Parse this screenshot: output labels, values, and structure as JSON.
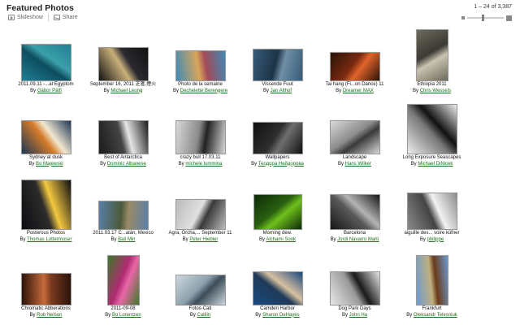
{
  "header": {
    "title": "Featured Photos",
    "slideshow_label": "Slideshow",
    "share_label": "Share",
    "pager_text": "1 – 24 of 3,387",
    "size_level": 0.4
  },
  "photos": [
    {
      "caption": "2011.09.11 -...at Egyptom",
      "by": "By",
      "author": "Gábor Pálfi",
      "colors": [
        "#1f7f94",
        "#3aa0a8",
        "#0e4d60"
      ]
    },
    {
      "caption": "September 16, 2011 芝滙.煙火",
      "by": "By",
      "author": "Michael Leung",
      "colors": [
        "#111111",
        "#2a2a30",
        "#c9b07a"
      ]
    },
    {
      "caption": "Photo de la semaine",
      "by": "By",
      "author": "Dechelette Berengere",
      "colors": [
        "#3f8ab6",
        "#a24a5a",
        "#d8a65a"
      ]
    },
    {
      "caption": "Vissende Fuut",
      "by": "By",
      "author": "Jan Althof",
      "colors": [
        "#355b78",
        "#6f8fa6",
        "#1e3447"
      ]
    },
    {
      "caption": "Tai hang (Fi...on Dance) 11",
      "by": "By",
      "author": "Dreamer MAX",
      "colors": [
        "#2a1208",
        "#e0642a",
        "#7a2a10"
      ]
    },
    {
      "caption": "Ethiopia 2011",
      "by": "By",
      "author": "Chris Wessels",
      "colors": [
        "#6c6a5c",
        "#c9c3b0",
        "#3b3a33"
      ]
    },
    {
      "caption": "Sydney at dusk",
      "by": "By",
      "author": "Bo Majewski",
      "colors": [
        "#1b3556",
        "#f2e8d0",
        "#d47b2a"
      ]
    },
    {
      "caption": "Best of Antarctica",
      "by": "By",
      "author": "Dominic Albanese",
      "colors": [
        "#1a1a1a",
        "#e6e6e6",
        "#444444"
      ]
    },
    {
      "caption": "crazy bull 17.03.11",
      "by": "By",
      "author": "michele lummina",
      "colors": [
        "#d8d8d8",
        "#222222",
        "#8a8a8a"
      ]
    },
    {
      "caption": "Wallpapers",
      "by": "By",
      "author": "Теодора Нейдорова",
      "colors": [
        "#101010",
        "#6e6e6e",
        "#2e2e2e"
      ]
    },
    {
      "caption": "Landscape",
      "by": "By",
      "author": "Hans Wilker",
      "colors": [
        "#d9d9d9",
        "#3a3a3a",
        "#8c8c8c"
      ]
    },
    {
      "caption": "Long Exposure Seascapes",
      "by": "By",
      "author": "Michael DiNicek",
      "colors": [
        "#eeeeee",
        "#111111",
        "#777777"
      ]
    },
    {
      "caption": "Posterous Photos",
      "by": "By",
      "author": "Thomas Lottermoser",
      "colors": [
        "#0d0d12",
        "#f3c840",
        "#2c2c2c"
      ]
    },
    {
      "caption": "2011.03.17 C...atán, Mexico",
      "by": "By",
      "author": "Bali Min",
      "colors": [
        "#5a7fa8",
        "#9a8a66",
        "#4a5a3a"
      ]
    },
    {
      "caption": "Agra, Orcha,... September 11",
      "by": "By",
      "author": "Peter Hiebler",
      "colors": [
        "#bbbbbb",
        "#3a3a3a",
        "#e0e0e0"
      ]
    },
    {
      "caption": "Morning dew.",
      "by": "By",
      "author": "Alchami Sook",
      "colors": [
        "#0d2a08",
        "#6ec01c",
        "#2a6010"
      ]
    },
    {
      "caption": "Barcelona",
      "by": "By",
      "author": "Jordi Navarro Martí",
      "colors": [
        "#151515",
        "#b4b4b4",
        "#5a5a5a"
      ]
    },
    {
      "caption": "aiguille des... voire küfner",
      "by": "By",
      "author": "philippe",
      "colors": [
        "#8a8a8a",
        "#f2f2f2",
        "#444444"
      ]
    },
    {
      "caption": "Chromatic Abberations",
      "by": "By",
      "author": "Rob Nelson",
      "colors": [
        "#2a1208",
        "#7a3a20",
        "#c66a3a"
      ]
    },
    {
      "caption": "2011-09-08",
      "by": "By",
      "author": "Bo Lorentzen",
      "colors": [
        "#3c7a2a",
        "#e866a6",
        "#b02a72"
      ]
    },
    {
      "caption": "Fotos-Cati",
      "by": "By",
      "author": "Catilin",
      "colors": [
        "#cdd8de",
        "#3c4c58",
        "#8ca0ac"
      ]
    },
    {
      "caption": "Camden Harbor",
      "by": "By",
      "author": "Sharon DeHayes",
      "colors": [
        "#1a4a80",
        "#d8c0a0",
        "#203a58"
      ]
    },
    {
      "caption": "Dog Park Days",
      "by": "By",
      "author": "John Ha",
      "colors": [
        "#e8e8e8",
        "#1a1a1a",
        "#9a9a9a"
      ]
    },
    {
      "caption": "Frankfurt",
      "by": "By",
      "author": "Oleksandr Telesniuk",
      "colors": [
        "#6a9ad0",
        "#6a3a1a",
        "#c0b080"
      ]
    }
  ]
}
